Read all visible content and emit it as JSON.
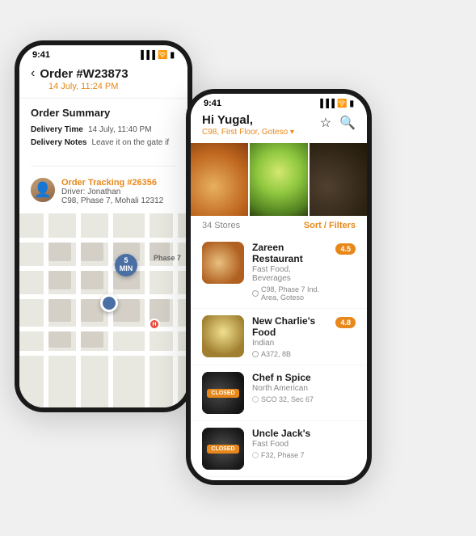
{
  "phone1": {
    "status_time": "9:41",
    "header": {
      "back_label": "‹",
      "title": "Order #W23873",
      "date": "14 July, 11:24 PM"
    },
    "summary": {
      "section_title": "Order Summary",
      "delivery_time_label": "Delivery Time",
      "delivery_time_value": "14 July, 11:40 PM",
      "delivery_notes_label": "Delivery Notes",
      "delivery_notes_value": "Leave it on the gate if"
    },
    "tracking": {
      "title": "Order Tracking #26356",
      "driver_label": "Driver: Jonathan",
      "address": "C98, Phase 7, Mohali 12312"
    },
    "map": {
      "delivery_label": "5\nMIN",
      "phase_label": "Phase 7"
    }
  },
  "phone2": {
    "status_time": "9:41",
    "header": {
      "greeting": "Hi Yugal,",
      "location": "C98, First Floor, Goteso ▾",
      "wishlist_icon": "☆",
      "search_icon": "🔍"
    },
    "stores": {
      "count": "34 Stores",
      "sort_label": "Sort / Filters"
    },
    "restaurants": [
      {
        "name": "Zareen Restaurant",
        "cuisine": "Fast Food, Beverages",
        "address": "C98, Phase 7 Ind. Area, Goteso",
        "rating": "4.5",
        "closed": false,
        "img_class": "rest-img-1"
      },
      {
        "name": "New Charlie's Food",
        "cuisine": "Indian",
        "address": "A372, 8B",
        "rating": "4.8",
        "closed": false,
        "img_class": "rest-img-2"
      },
      {
        "name": "Chef n Spice",
        "cuisine": "North American",
        "address": "SCO 32, Sec 67",
        "rating": "",
        "closed": true,
        "img_class": "rest-img-3"
      },
      {
        "name": "Uncle Jack's",
        "cuisine": "Fast Food",
        "address": "F32, Phase 7",
        "rating": "",
        "closed": true,
        "img_class": "rest-img-4"
      }
    ]
  }
}
